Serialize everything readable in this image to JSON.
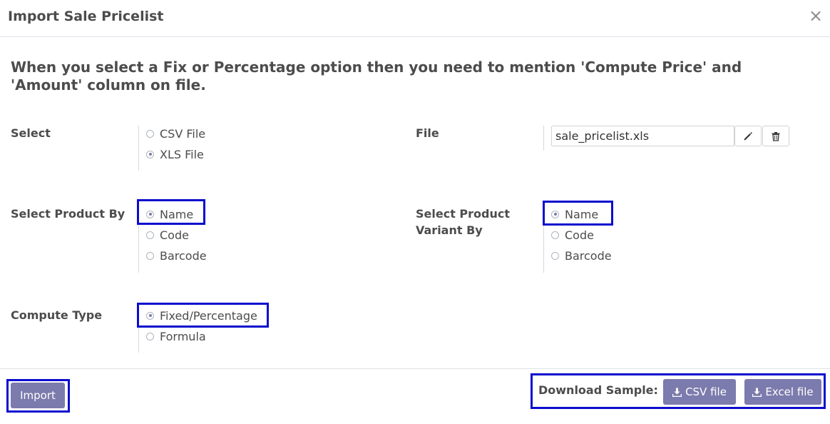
{
  "dialog": {
    "title": "Import Sale Pricelist",
    "close_symbol": "×",
    "notice": "When you select a Fix or Percentage option then you need to mention 'Compute Price' and 'Amount' column on file."
  },
  "select": {
    "label": "Select",
    "options": [
      {
        "label": "CSV File",
        "checked": false
      },
      {
        "label": "XLS File",
        "checked": true
      }
    ]
  },
  "file": {
    "label": "File",
    "value": "sale_pricelist.xls",
    "edit_icon": "pencil-icon",
    "delete_icon": "trash-icon"
  },
  "product_by": {
    "label": "Select Product By",
    "options": [
      {
        "label": "Name",
        "checked": true
      },
      {
        "label": "Code",
        "checked": false
      },
      {
        "label": "Barcode",
        "checked": false
      }
    ]
  },
  "variant_by": {
    "label_line1": "Select Product",
    "label_line2": "Variant By",
    "options": [
      {
        "label": "Name",
        "checked": true
      },
      {
        "label": "Code",
        "checked": false
      },
      {
        "label": "Barcode",
        "checked": false
      }
    ]
  },
  "compute_type": {
    "label": "Compute Type",
    "options": [
      {
        "label": "Fixed/Percentage",
        "checked": true
      },
      {
        "label": "Formula",
        "checked": false
      }
    ]
  },
  "footer": {
    "import_label": "Import",
    "download_label": "Download Sample:",
    "csv_label": "CSV file",
    "excel_label": "Excel file",
    "download_icon": "download-icon"
  },
  "colors": {
    "primary": "#7c7bad",
    "highlight": "#0c0ccf",
    "text": "#4c4c4c"
  }
}
